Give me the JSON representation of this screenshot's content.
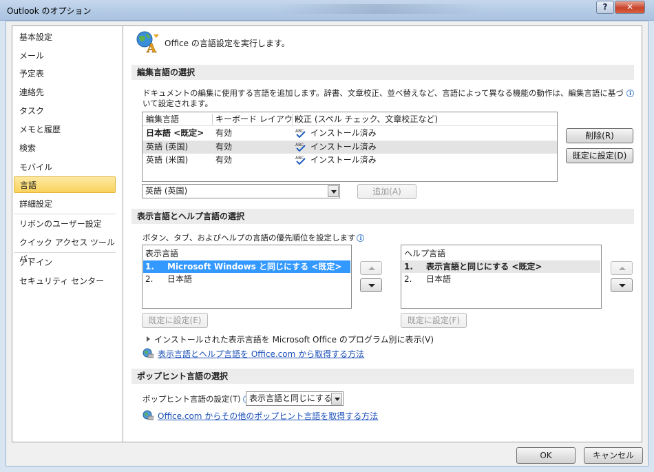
{
  "window": {
    "title": "Outlook のオプション"
  },
  "sidebar": {
    "items": [
      {
        "label": "基本設定"
      },
      {
        "label": "メール"
      },
      {
        "label": "予定表"
      },
      {
        "label": "連絡先"
      },
      {
        "label": "タスク"
      },
      {
        "label": "メモと履歴"
      },
      {
        "label": "検索"
      },
      {
        "label": "モバイル"
      },
      {
        "label": "言語"
      },
      {
        "label": "詳細設定"
      },
      {
        "label": "リボンのユーザー設定"
      },
      {
        "label": "クイック アクセス ツール バー"
      },
      {
        "label": "アドイン"
      },
      {
        "label": "セキュリティ センター"
      }
    ],
    "active": "言語"
  },
  "header": {
    "text": "Office の言語設定を実行します。"
  },
  "editing": {
    "section_title": "編集言語の選択",
    "description": "ドキュメントの編集に使用する言語を追加します。辞書、文章校正、並べ替えなど、言語によって異なる機能の動作は、編集言語に基づいて設定されます。",
    "columns": [
      "編集言語",
      "キーボード レイアウト",
      "校正 (スペル チェック、文章校正など)"
    ],
    "rows": [
      {
        "lang": "日本語 <既定>",
        "keyboard": "有効",
        "proofing": "インストール済み"
      },
      {
        "lang": "英語 (英国)",
        "keyboard": "有効",
        "proofing": "インストール済み"
      },
      {
        "lang": "英語 (米国)",
        "keyboard": "有効",
        "proofing": "インストール済み"
      }
    ],
    "remove_button": "削除(R)",
    "set_default_button": "既定に設定(D)",
    "add_combo_value": "英語 (英国)",
    "add_button": "追加(A)"
  },
  "display": {
    "section_title": "表示言語とヘルプ言語の選択",
    "description": "ボタン、タブ、およびヘルプの言語の優先順位を設定します",
    "display_list": {
      "header": "表示言語",
      "items": [
        {
          "num": "1.",
          "label": "Microsoft Windows と同じにする <既定>"
        },
        {
          "num": "2.",
          "label": "日本語"
        }
      ]
    },
    "help_list": {
      "header": "ヘルプ言語",
      "items": [
        {
          "num": "1.",
          "label": "表示言語と同じにする <既定>"
        },
        {
          "num": "2.",
          "label": "日本語"
        }
      ]
    },
    "set_default_display": "既定に設定(E)",
    "set_default_help": "既定に設定(F)",
    "expander": "インストールされた表示言語を Microsoft Office のプログラム別に表示(V)",
    "link": "表示言語とヘルプ言語を Office.com から取得する方法"
  },
  "screentip": {
    "section_title": "ポップヒント言語の選択",
    "label": "ポップヒント言語の設定(T)",
    "combo_value": "表示言語と同じにする",
    "link": "Office.com からその他のポップヒント言語を取得する方法"
  },
  "footer": {
    "ok": "OK",
    "cancel": "キャンセル"
  },
  "colors": {
    "accent_selected": "#3399ff",
    "nav_active": "#f9d25c",
    "link": "#1a4fb8"
  },
  "icons": [
    "office-language-icon",
    "info-icon",
    "spellcheck-icon",
    "globe-link-icon",
    "dropdown-arrow-icon",
    "expand-triangle-icon",
    "help-icon",
    "close-icon"
  ]
}
